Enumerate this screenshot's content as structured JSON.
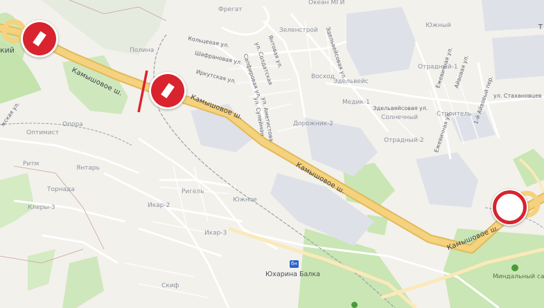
{
  "map": {
    "highway_labels": [
      "Камышовое ш.",
      "Камышовое ш.",
      "Камышовое ш.",
      "Камышовое ш."
    ],
    "districts": [
      "Полина",
      "Оптимист",
      "Опора",
      "Ритм",
      "Янтарь",
      "Торнада",
      "Клеры-3",
      "Ригель",
      "Южное",
      "Икар-2",
      "Икар-3",
      "Скиф",
      "Фрегат",
      "Зеленстрой",
      "Восход",
      "Эдельвейс",
      "Медик-1",
      "Дорожник-2",
      "Солнечный",
      "Отрадный-2",
      "Строитель",
      "Отрадный-1",
      "Южный",
      "Океан МГИ"
    ],
    "streets": [
      "Кольцевая ул.",
      "Шафрановая ул.",
      "Иркутская ул.",
      "Янтовая ул.",
      "ул. Солдатская",
      "Сапфировая ул.",
      "ул. Аметистова",
      "ул. Сулейман",
      "Эдельвейсовая ул.",
      "Ежевичная ул.",
      "Айвовая ул.",
      "ул. Стахановцев",
      "1-й Айвовый пер.",
      "Ежевичная ул."
    ],
    "partial_labels": [
      "кий",
      "жская ул.",
      "Т"
    ],
    "metro_icon": "бн",
    "station": "Юхарина Балка",
    "park": "Миндальный сад"
  },
  "signs": [
    {
      "name": "no-entry-sign-1",
      "icon": "no-entry-icon"
    },
    {
      "name": "no-entry-sign-2",
      "icon": "no-entry-icon"
    },
    {
      "name": "empty-circle-sign",
      "icon": "restriction-circle-icon"
    }
  ],
  "colors": {
    "background": "#f3f1ec",
    "park_green": "#c9e6b4",
    "highway": "#f5d27d",
    "highway_edge": "#e2b95a",
    "industrial": "#dfe1e9",
    "sign_red": "#d9232e",
    "closure_line": "#d9232e"
  }
}
